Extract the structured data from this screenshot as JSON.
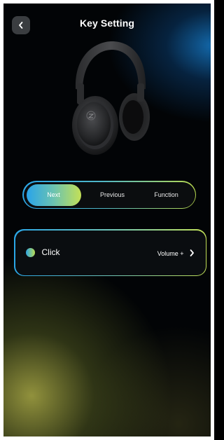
{
  "header": {
    "title": "Key Setting"
  },
  "product": {
    "image": "headphones"
  },
  "segments": {
    "options": [
      "Next",
      "Previous",
      "Function"
    ],
    "selected": "Next"
  },
  "key_row": {
    "label": "Click",
    "value": "Volume +"
  },
  "colors": {
    "accent_start": "#29a4ea",
    "accent_end": "#c4e056"
  },
  "icons": {
    "back": "chevron-left-icon",
    "row": "chevron-right-icon"
  }
}
